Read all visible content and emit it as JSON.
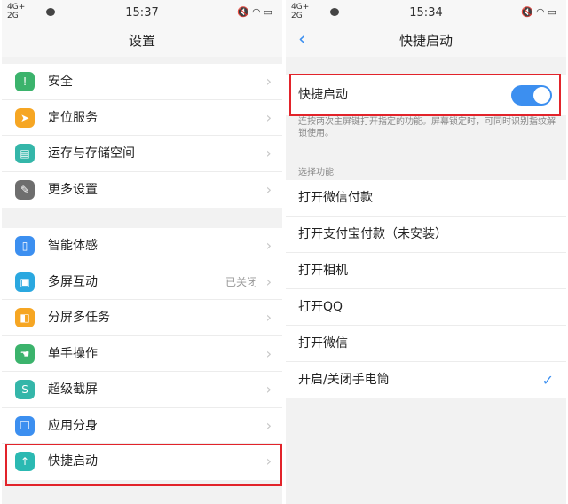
{
  "status_left": {
    "net_top": "4G+",
    "net_bottom": "2G",
    "time": "15:37"
  },
  "status_right": {
    "net_top": "4G+",
    "net_bottom": "2G",
    "time": "15:34"
  },
  "settings": {
    "title": "设置",
    "group1": [
      {
        "label": "安全",
        "icon": "shield-icon",
        "color": "#3bb36c",
        "glyph": "!"
      },
      {
        "label": "定位服务",
        "icon": "location-arrow-icon",
        "color": "#f6a623",
        "glyph": "➤"
      },
      {
        "label": "运存与存储空间",
        "icon": "storage-icon",
        "color": "#34b6a9",
        "glyph": "▤"
      },
      {
        "label": "更多设置",
        "icon": "wrench-icon",
        "color": "#6e6e6e",
        "glyph": "✎"
      }
    ],
    "group2": [
      {
        "label": "智能体感",
        "icon": "phone-motion-icon",
        "color": "#3c8ff0",
        "glyph": "▯",
        "value": ""
      },
      {
        "label": "多屏互动",
        "icon": "multiscreen-icon",
        "color": "#2aa8e0",
        "glyph": "▣",
        "value": "已关闭"
      },
      {
        "label": "分屏多任务",
        "icon": "split-screen-icon",
        "color": "#f6a623",
        "glyph": "◧",
        "value": ""
      },
      {
        "label": "单手操作",
        "icon": "one-hand-icon",
        "color": "#3bb36c",
        "glyph": "☚",
        "value": ""
      },
      {
        "label": "超级截屏",
        "icon": "screenshot-icon",
        "color": "#34b6a9",
        "glyph": "S",
        "value": ""
      },
      {
        "label": "应用分身",
        "icon": "app-clone-icon",
        "color": "#3c8ff0",
        "glyph": "❐",
        "value": ""
      },
      {
        "label": "快捷启动",
        "icon": "quick-launch-icon",
        "color": "#2bb9b2",
        "glyph": "↑",
        "value": ""
      }
    ]
  },
  "quick": {
    "title": "快捷启动",
    "toggle_label": "快捷启动",
    "toggle_on": true,
    "description": "连按两次主屏键打开指定的功能。屏幕锁定时，可同时识别指纹解锁使用。",
    "section_title": "选择功能",
    "options": [
      {
        "label": "打开微信付款",
        "checked": false
      },
      {
        "label": "打开支付宝付款（未安装）",
        "checked": false
      },
      {
        "label": "打开相机",
        "checked": false
      },
      {
        "label": "打开QQ",
        "checked": false
      },
      {
        "label": "打开微信",
        "checked": false
      },
      {
        "label": "开启/关闭手电筒",
        "checked": true
      }
    ]
  },
  "accent_color": "#3c8ff0",
  "highlight_color": "#e2232a"
}
